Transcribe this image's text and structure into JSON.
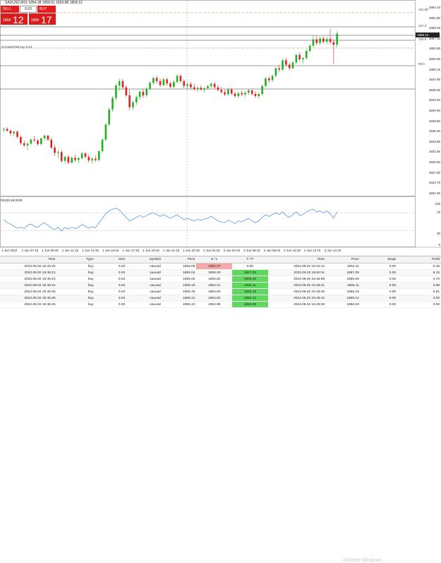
{
  "symbol_title": "XAUUSD,M15  1854.38 1858.61 1853.88 1858.12",
  "one_click": {
    "sell_label": "SELL",
    "buy_label": "BUY",
    "lot": "0.03",
    "sell_small": "1858",
    "sell_big": "12",
    "buy_small": "1858",
    "buy_big": "17"
  },
  "price_axis": [
    "1864.10",
    "1861.80",
    "1859.45",
    "1857.10",
    "1854.80",
    "1852.50",
    "1850.15",
    "1847.85",
    "1845.55",
    "1843.20",
    "1840.90",
    "1838.60",
    "1836.30",
    "1833.95",
    "1831.65",
    "1829.30",
    "1827.00",
    "1824.70",
    "1822.35"
  ],
  "current_price": "1858.12",
  "levels": {
    "l1": "181.80",
    "l2": "127.3",
    "l3": "100.0",
    "l4": "90.0"
  },
  "order_line_label": "#123456789 buy 0.03",
  "rsi_title": "RSI(9) 69.9339",
  "rsi_axis": [
    "100",
    "70",
    "30",
    "0"
  ],
  "time_axis": [
    "1 Jun 2022",
    "1 Jun 07:15",
    "1 Jun 09:15",
    "1 Jun 11:15",
    "1 Jun 13:15",
    "1 Jun 15:15",
    "1 Jun 17:15",
    "1 Jun 19:15",
    "1 Jun 21:15",
    "1 Jun 23:15",
    "2 Jun 02:15",
    "2 Jun 04:15",
    "2 Jun 06:15",
    "2 Jun 08:15",
    "2 Jun 10:15",
    "2 Jun 12:15",
    "2 Jun 14:15"
  ],
  "candles": [
    [
      1836.4,
      1836.9,
      1835.9,
      1836.6
    ],
    [
      1836.6,
      1837.0,
      1836.0,
      1836.2
    ],
    [
      1836.2,
      1836.5,
      1835.0,
      1835.6
    ],
    [
      1835.6,
      1836.2,
      1835.0,
      1836.0
    ],
    [
      1836.0,
      1836.3,
      1834.5,
      1834.8
    ],
    [
      1834.8,
      1835.2,
      1833.0,
      1833.4
    ],
    [
      1833.4,
      1834.0,
      1832.5,
      1832.9
    ],
    [
      1832.9,
      1833.6,
      1831.8,
      1833.3
    ],
    [
      1833.3,
      1834.5,
      1833.0,
      1834.2
    ],
    [
      1834.2,
      1835.0,
      1833.6,
      1834.0
    ],
    [
      1834.0,
      1834.4,
      1832.8,
      1833.2
    ],
    [
      1833.2,
      1834.6,
      1832.9,
      1834.5
    ],
    [
      1834.5,
      1835.4,
      1834.0,
      1835.1
    ],
    [
      1835.1,
      1835.3,
      1833.8,
      1834.2
    ],
    [
      1834.2,
      1834.6,
      1832.0,
      1832.4
    ],
    [
      1832.4,
      1833.0,
      1830.5,
      1831.2
    ],
    [
      1831.2,
      1831.8,
      1830.0,
      1831.4
    ],
    [
      1831.4,
      1831.9,
      1829.0,
      1829.4
    ],
    [
      1829.4,
      1830.6,
      1828.8,
      1830.3
    ],
    [
      1830.3,
      1830.7,
      1828.6,
      1829.0
    ],
    [
      1829.0,
      1830.4,
      1828.7,
      1830.1
    ],
    [
      1830.1,
      1830.8,
      1829.2,
      1829.6
    ],
    [
      1829.6,
      1830.3,
      1828.9,
      1830.0
    ],
    [
      1830.0,
      1831.4,
      1829.7,
      1831.1
    ],
    [
      1831.1,
      1831.5,
      1829.9,
      1830.3
    ],
    [
      1830.3,
      1830.9,
      1829.0,
      1829.5
    ],
    [
      1829.5,
      1830.2,
      1828.8,
      1829.9
    ],
    [
      1829.9,
      1830.6,
      1829.2,
      1829.6
    ],
    [
      1829.6,
      1831.8,
      1829.3,
      1831.6
    ],
    [
      1831.6,
      1834.5,
      1831.2,
      1834.2
    ],
    [
      1834.2,
      1838.0,
      1833.8,
      1837.6
    ],
    [
      1837.6,
      1841.5,
      1837.2,
      1841.0
    ],
    [
      1841.0,
      1844.0,
      1840.5,
      1843.6
    ],
    [
      1843.6,
      1846.8,
      1843.0,
      1846.4
    ],
    [
      1846.4,
      1848.0,
      1845.2,
      1847.4
    ],
    [
      1847.4,
      1847.9,
      1845.5,
      1846.0
    ],
    [
      1846.0,
      1846.4,
      1843.8,
      1844.2
    ],
    [
      1844.2,
      1845.5,
      1840.8,
      1841.5
    ],
    [
      1841.5,
      1843.0,
      1840.8,
      1842.6
    ],
    [
      1842.6,
      1844.2,
      1842.0,
      1843.8
    ],
    [
      1843.8,
      1845.4,
      1843.2,
      1845.0
    ],
    [
      1845.0,
      1845.6,
      1843.6,
      1844.2
    ],
    [
      1844.2,
      1846.0,
      1843.8,
      1845.7
    ],
    [
      1845.7,
      1847.4,
      1845.3,
      1847.0
    ],
    [
      1847.0,
      1848.4,
      1846.6,
      1848.1
    ],
    [
      1848.1,
      1848.6,
      1846.8,
      1847.4
    ],
    [
      1847.4,
      1848.0,
      1846.0,
      1846.5
    ],
    [
      1846.5,
      1848.3,
      1846.2,
      1847.8
    ],
    [
      1847.8,
      1848.2,
      1846.4,
      1846.9
    ],
    [
      1846.9,
      1847.3,
      1845.7,
      1846.1
    ],
    [
      1846.1,
      1847.6,
      1845.8,
      1847.2
    ],
    [
      1847.2,
      1848.9,
      1846.9,
      1848.6
    ],
    [
      1848.6,
      1849.0,
      1847.0,
      1847.4
    ],
    [
      1847.4,
      1847.8,
      1845.8,
      1846.3
    ],
    [
      1846.3,
      1847.0,
      1845.5,
      1846.7
    ],
    [
      1846.7,
      1847.2,
      1845.6,
      1846.0
    ],
    [
      1846.0,
      1846.8,
      1845.3,
      1845.6
    ],
    [
      1845.6,
      1846.2,
      1844.9,
      1845.9
    ],
    [
      1845.9,
      1846.5,
      1845.2,
      1845.5
    ],
    [
      1845.5,
      1846.0,
      1844.8,
      1845.8
    ],
    [
      1845.8,
      1846.6,
      1845.4,
      1846.3
    ],
    [
      1846.3,
      1847.1,
      1845.9,
      1846.8
    ],
    [
      1846.8,
      1847.2,
      1845.6,
      1846.0
    ],
    [
      1846.0,
      1846.5,
      1845.1,
      1845.4
    ],
    [
      1845.4,
      1846.1,
      1844.6,
      1844.9
    ],
    [
      1844.9,
      1845.5,
      1844.0,
      1844.4
    ],
    [
      1844.4,
      1845.8,
      1844.0,
      1845.5
    ],
    [
      1845.5,
      1845.9,
      1844.2,
      1844.6
    ],
    [
      1844.6,
      1845.1,
      1843.7,
      1844.0
    ],
    [
      1844.0,
      1845.0,
      1843.6,
      1844.7
    ],
    [
      1844.7,
      1845.3,
      1844.0,
      1844.4
    ],
    [
      1844.4,
      1845.0,
      1843.8,
      1844.8
    ],
    [
      1844.8,
      1845.6,
      1844.3,
      1845.3
    ],
    [
      1845.3,
      1845.7,
      1844.1,
      1844.5
    ],
    [
      1844.5,
      1845.2,
      1843.6,
      1844.0
    ],
    [
      1844.0,
      1844.8,
      1843.4,
      1844.5
    ],
    [
      1844.5,
      1846.6,
      1844.2,
      1846.3
    ],
    [
      1846.3,
      1848.4,
      1846.0,
      1848.0
    ],
    [
      1848.0,
      1848.5,
      1847.0,
      1847.6
    ],
    [
      1847.6,
      1848.9,
      1847.2,
      1848.6
    ],
    [
      1848.6,
      1850.6,
      1848.2,
      1850.3
    ],
    [
      1850.3,
      1851.0,
      1849.5,
      1850.0
    ],
    [
      1850.0,
      1852.4,
      1849.7,
      1852.1
    ],
    [
      1852.1,
      1852.6,
      1850.7,
      1851.1
    ],
    [
      1851.1,
      1851.6,
      1849.8,
      1850.3
    ],
    [
      1850.3,
      1851.9,
      1850.0,
      1851.6
    ],
    [
      1851.6,
      1853.6,
      1851.3,
      1853.3
    ],
    [
      1853.3,
      1853.9,
      1851.9,
      1852.3
    ],
    [
      1852.3,
      1852.8,
      1851.3,
      1852.6
    ],
    [
      1852.6,
      1854.6,
      1852.2,
      1854.2
    ],
    [
      1854.2,
      1855.8,
      1853.8,
      1855.4
    ],
    [
      1855.4,
      1857.8,
      1855.0,
      1856.8
    ],
    [
      1856.8,
      1857.6,
      1855.5,
      1856.0
    ],
    [
      1856.0,
      1857.4,
      1855.6,
      1857.0
    ],
    [
      1857.0,
      1857.5,
      1855.9,
      1856.3
    ],
    [
      1856.3,
      1857.4,
      1855.8,
      1856.9
    ],
    [
      1856.9,
      1859.2,
      1855.8,
      1856.2
    ],
    [
      1856.2,
      1856.8,
      1851.2,
      1855.6
    ],
    [
      1855.6,
      1858.6,
      1855.0,
      1858.1
    ]
  ],
  "rsi_values": [
    55,
    48,
    45,
    40,
    36,
    38,
    35,
    42,
    45,
    40,
    38,
    44,
    48,
    42,
    36,
    33,
    38,
    30,
    37,
    34,
    38,
    35,
    38,
    44,
    40,
    36,
    39,
    37,
    48,
    58,
    68,
    74,
    78,
    80,
    76,
    68,
    60,
    52,
    56,
    60,
    64,
    60,
    64,
    68,
    70,
    66,
    62,
    66,
    62,
    58,
    62,
    66,
    60,
    55,
    58,
    54,
    52,
    56,
    53,
    56,
    58,
    62,
    57,
    52,
    50,
    48,
    54,
    50,
    46,
    52,
    50,
    54,
    58,
    52,
    48,
    52,
    60,
    66,
    62,
    66,
    70,
    66,
    72,
    64,
    60,
    66,
    72,
    64,
    66,
    72,
    76,
    78,
    72,
    74,
    70,
    74,
    68,
    58,
    72
  ],
  "terminal": {
    "left_headers": [
      "Time",
      "Type",
      "Size",
      "Symbol",
      "Price",
      "S / L",
      "T / P"
    ],
    "right_headers": [
      "Time",
      "Price",
      "Swap",
      "Profit"
    ],
    "rows": [
      [
        "2022.06.02 15:40:25",
        "buy",
        "0.03",
        "xauusd",
        "1853.09",
        "1854.27",
        "0.00",
        "2022.06.02 15:42:14",
        "1854.11",
        "0.00",
        "0.45"
      ],
      [
        "2022.06.02 15:46:21",
        "buy",
        "0.03",
        "xauusd",
        "1855.04",
        "1855.30",
        "1857.05",
        "2022.06.02 15:50:11",
        "1857.09",
        "0.00",
        "6.15"
      ],
      [
        "2022.06.02 15:46:23",
        "buy",
        "0.03",
        "xauusd",
        "1855.02",
        "1853.82",
        "1855.02",
        "2022.06.02 15:46:08",
        "1855.93",
        "0.00",
        "2.70"
      ],
      [
        "2022.06.02 15:46:24",
        "buy",
        "0.03",
        "xauusd",
        "1855.19",
        "1854.01",
        "1856.11",
        "2022.06.02 15:48:31",
        "1856.11",
        "0.00",
        "2.88"
      ],
      [
        "2022.06.02 15:46:25",
        "buy",
        "0.03",
        "xauusd",
        "1855.19",
        "1854.03",
        "1856.15",
        "2022.06.02 15:48:40",
        "1856.16",
        "0.00",
        "2.91"
      ],
      [
        "2022.06.02 15:46:25",
        "buy",
        "0.03",
        "xauusd",
        "1855.12",
        "1854.02",
        "1856.12",
        "2022.06.02 15:48:42",
        "1856.12",
        "0.00",
        "3.00"
      ],
      [
        "2022.06.02 15:46:26",
        "buy",
        "0.03",
        "xauusd",
        "1855.10",
        "1853.99",
        "1856.09",
        "2022.06.02 15:48:29",
        "1856.10",
        "0.00",
        "3.00"
      ]
    ],
    "sl_highlight_row": 0,
    "tp_highlight_rows": [
      1,
      2,
      3,
      4,
      5,
      6
    ]
  },
  "watermark": "Activate Windows",
  "colors": {
    "bull": "#22b022",
    "bear": "#e02020",
    "rsi": "#3a8ee6",
    "accent_red": "#d91c1c"
  }
}
